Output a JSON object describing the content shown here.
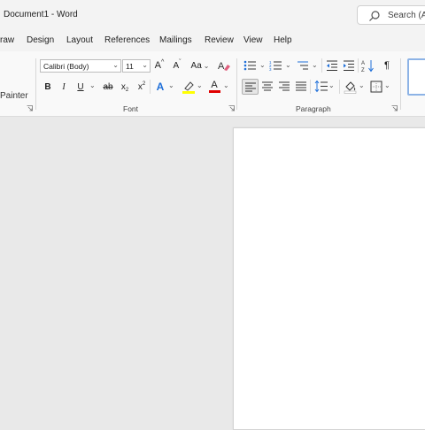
{
  "window": {
    "title": "Document1  -  Word"
  },
  "search": {
    "placeholder": "Search (Al"
  },
  "menu": {
    "tabs": [
      {
        "label": "raw"
      },
      {
        "label": "Design"
      },
      {
        "label": "Layout"
      },
      {
        "label": "References"
      },
      {
        "label": "Mailings"
      },
      {
        "label": "Review"
      },
      {
        "label": "View"
      },
      {
        "label": "Help"
      }
    ]
  },
  "clipboard": {
    "format_painter_label": "Painter"
  },
  "font": {
    "group_label": "Font",
    "font_name": "Calibri (Body)",
    "font_size": "11",
    "grow_glyph": "A",
    "shrink_glyph": "A",
    "change_case_glyph": "Aa",
    "bold": "B",
    "italic": "I",
    "underline": "U",
    "strikethrough": "ab",
    "subscript": "x",
    "superscript": "x",
    "text_effects_glyph": "A",
    "font_color_glyph": "A"
  },
  "paragraph": {
    "group_label": "Paragraph",
    "pilcrow": "¶"
  },
  "colors": {
    "accent": "#185abd",
    "highlight": "#ffff00",
    "font_color": "#e00000",
    "style_border": "#8db3e6"
  }
}
